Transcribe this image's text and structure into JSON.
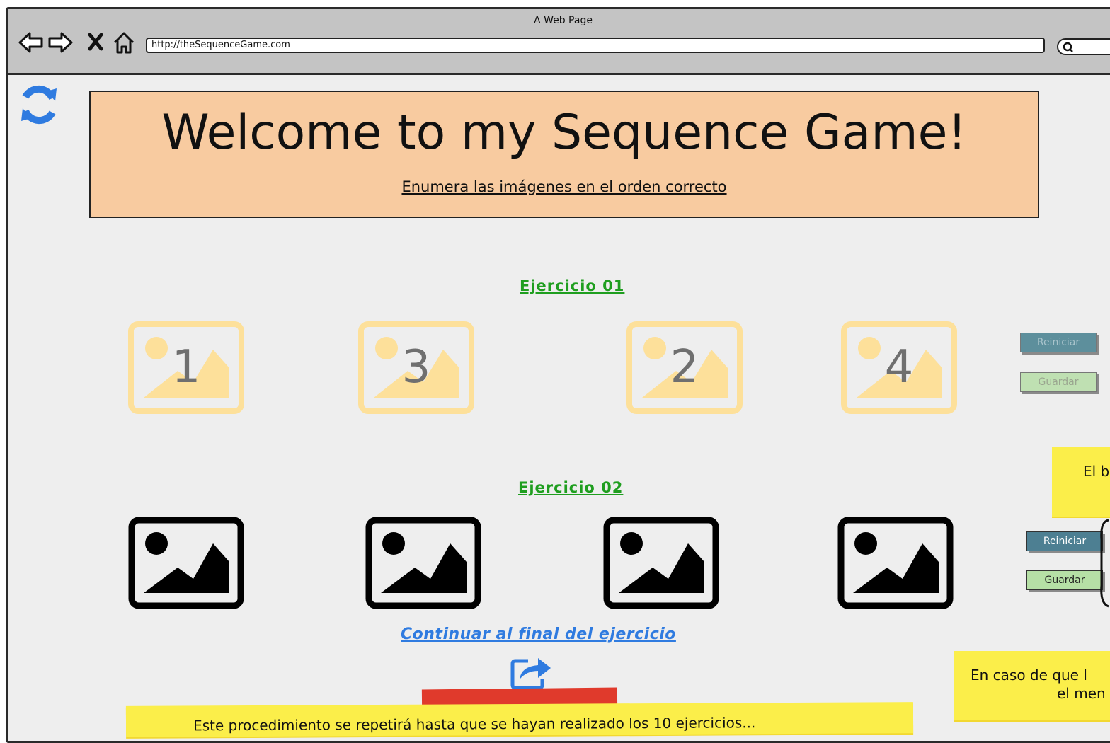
{
  "window": {
    "title": "A Web Page"
  },
  "browser": {
    "url": "http://theSequenceGame.com",
    "nav_icons": [
      "back-arrow-icon",
      "forward-arrow-icon",
      "close-x-icon",
      "home-icon"
    ],
    "search_icon": "search-icon"
  },
  "page": {
    "refresh_icon": "refresh-icon",
    "header": {
      "title": "Welcome to my Sequence Game!",
      "subtitle": "Enumera las imágenes en el orden correcto"
    },
    "exercise1": {
      "title": "Ejercicio 01",
      "numbers": [
        "1",
        "3",
        "2",
        "4"
      ],
      "reset_label": "Reiniciar",
      "save_label": "Guardar"
    },
    "exercise2": {
      "title": "Ejercicio 02",
      "reset_label": "Reiniciar",
      "save_label": "Guardar"
    },
    "continue_link": "Continuar al final del ejercicio",
    "share_icon": "share-arrow-icon"
  },
  "notes": {
    "right_top": "El b",
    "right_bottom_line1": "En caso de que l",
    "right_bottom_line2": "el men",
    "bottom": "Este procedimiento se repetirá hasta que se hayan realizado los 10 ejercicios..."
  },
  "colors": {
    "header_bg": "#f8cba0",
    "exercise_title": "#1f9e1f",
    "link": "#2f7be0",
    "sticky": "#fbee4a",
    "tape": "#e03a2c"
  }
}
